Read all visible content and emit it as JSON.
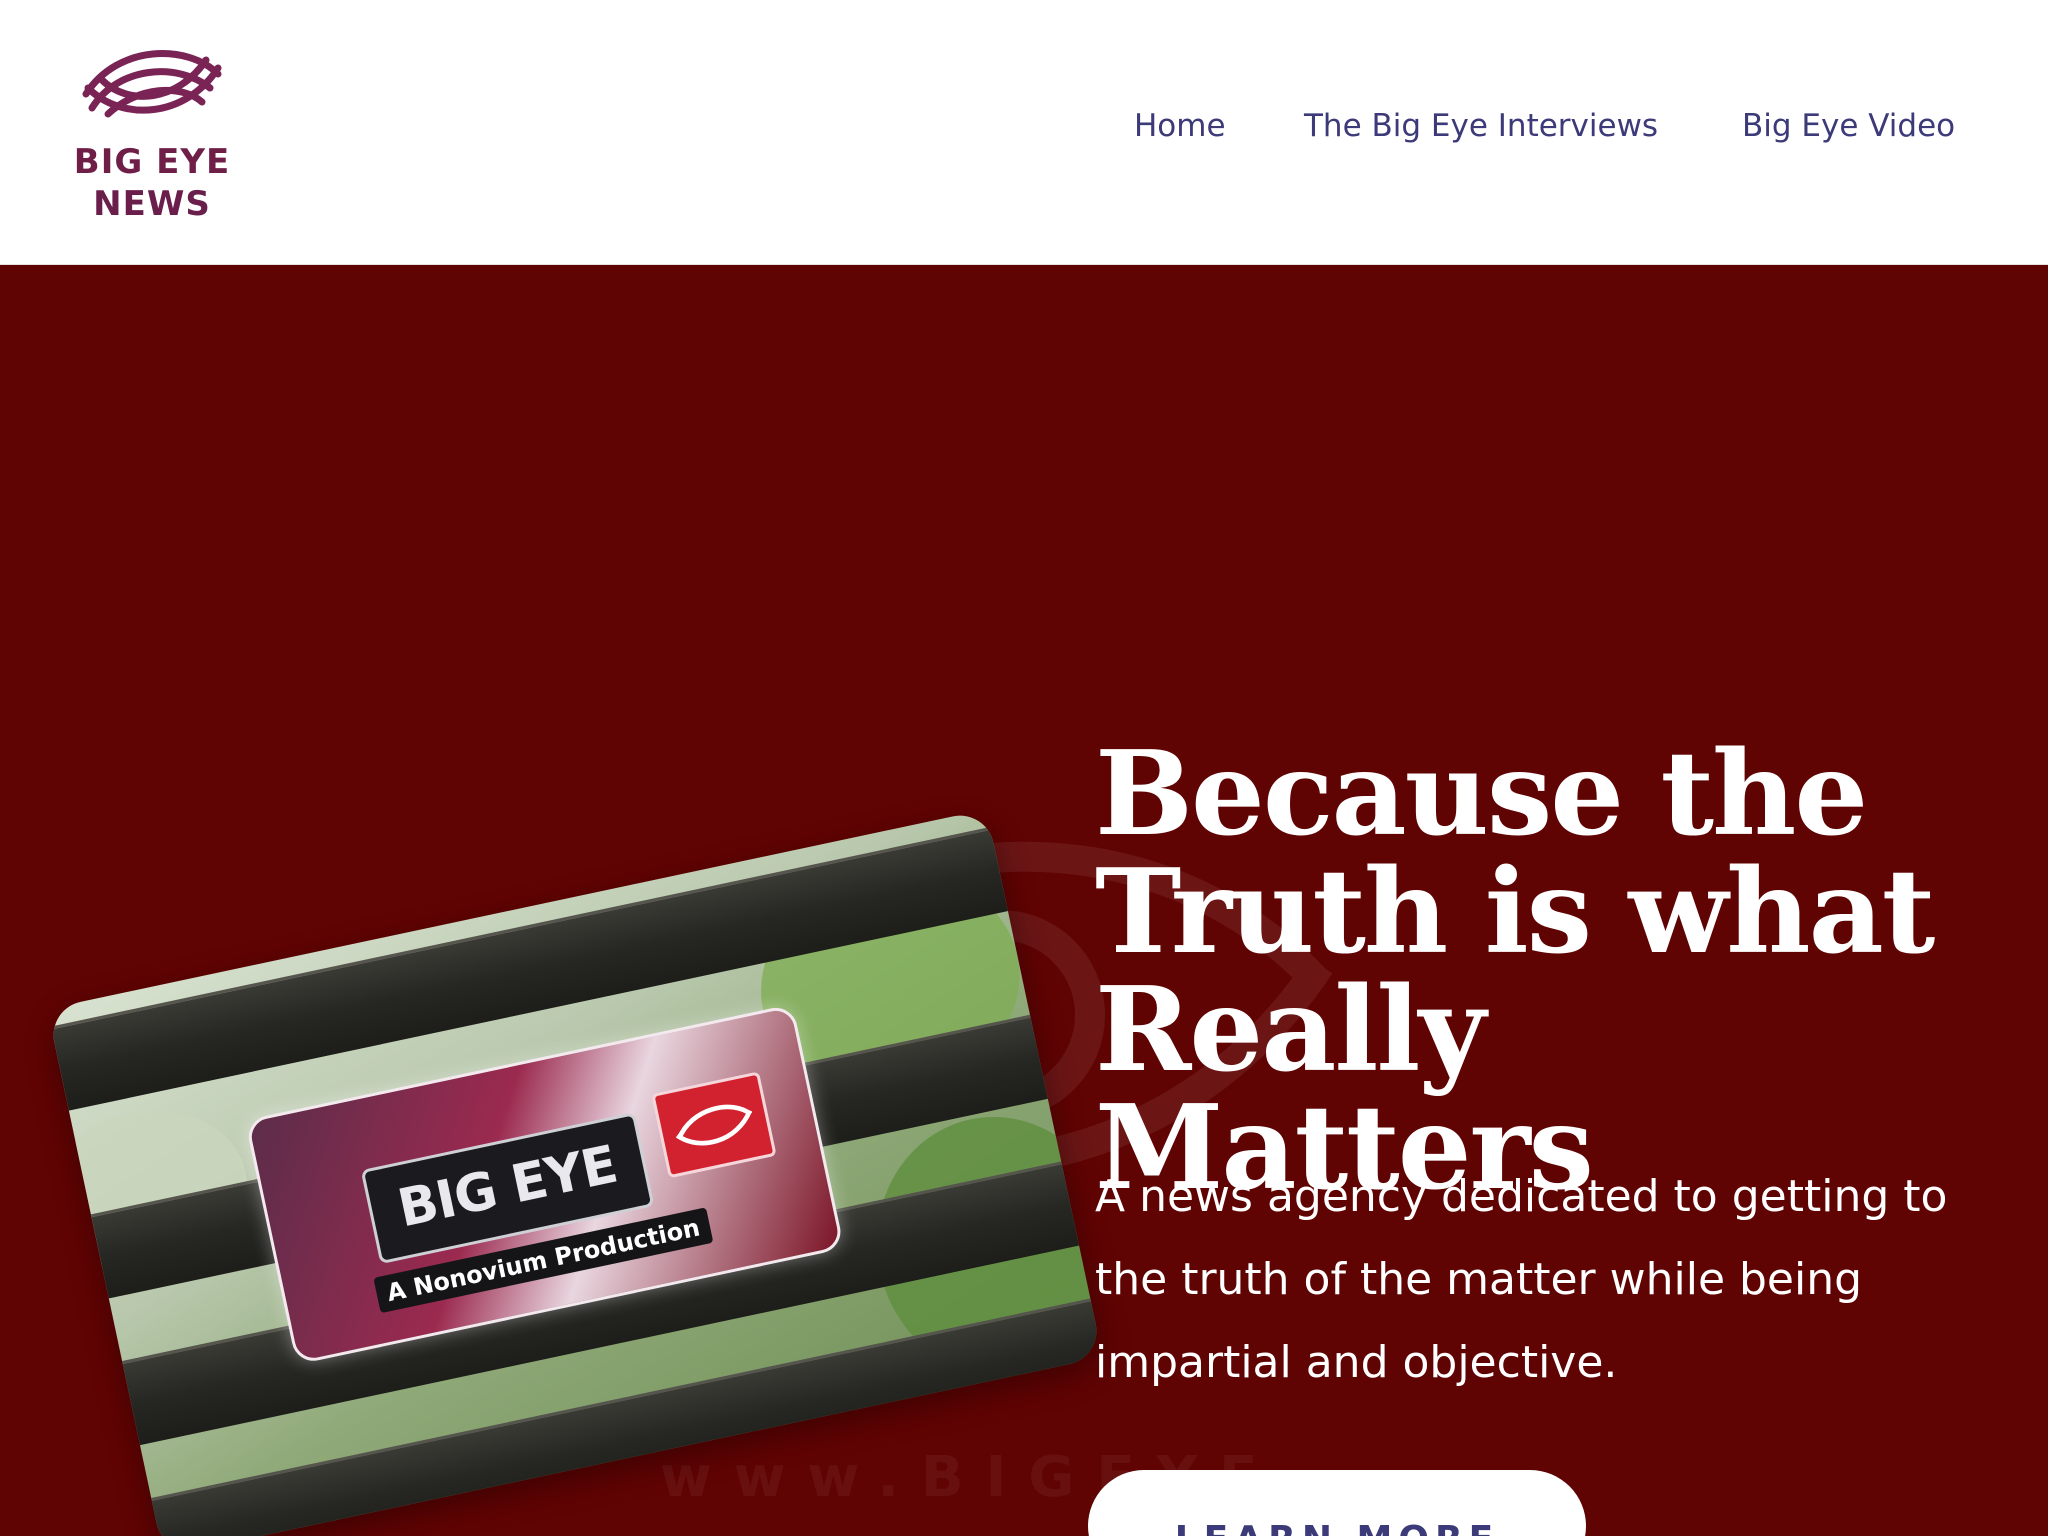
{
  "logo": {
    "line1": "BIG EYE",
    "line2": "NEWS",
    "icon": "eye-icon",
    "color": "#6f1f47"
  },
  "nav": {
    "items": [
      {
        "label": "Home"
      },
      {
        "label": "The Big Eye Interviews"
      },
      {
        "label": "Big Eye Video"
      }
    ],
    "color": "#3c3a78"
  },
  "hero": {
    "background": "#600303",
    "headline": "Because the Truth is what Really Matters",
    "subtext": "A news agency dedicated to getting to the truth of the matter while being impartial and objective.",
    "cta_label": "LEARN MORE",
    "image": {
      "sign_title": "BIG EYE",
      "sign_subtitle": "A Nonovium Production"
    },
    "watermark_text": "www.BIGEYE"
  }
}
